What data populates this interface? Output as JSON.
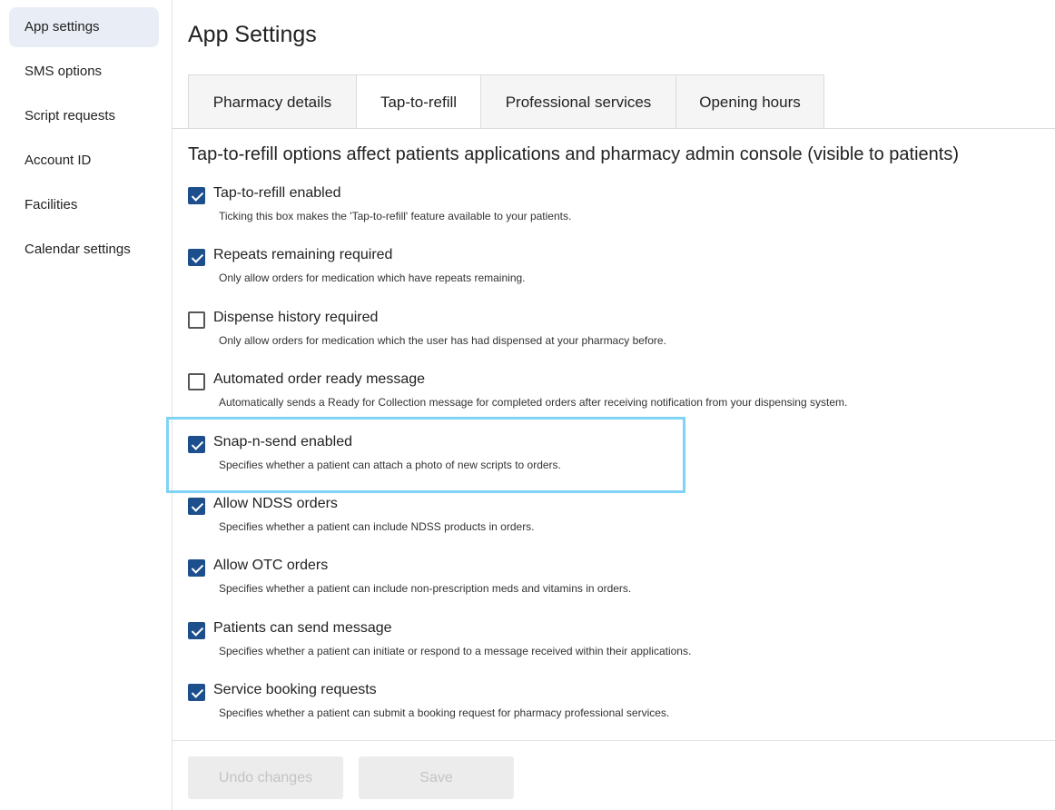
{
  "sidebar": {
    "items": [
      {
        "label": "App settings",
        "active": true
      },
      {
        "label": "SMS options"
      },
      {
        "label": "Script requests"
      },
      {
        "label": "Account ID"
      },
      {
        "label": "Facilities"
      },
      {
        "label": "Calendar settings"
      }
    ]
  },
  "page": {
    "title": "App Settings"
  },
  "tabs": [
    {
      "label": "Pharmacy details"
    },
    {
      "label": "Tap-to-refill",
      "active": true
    },
    {
      "label": "Professional services"
    },
    {
      "label": "Opening hours"
    }
  ],
  "section": {
    "heading": "Tap-to-refill options affect patients applications and pharmacy admin console (visible to patients)"
  },
  "options": [
    {
      "label": "Tap-to-refill enabled",
      "description": "Ticking this box makes the 'Tap-to-refill' feature available to your patients.",
      "checked": true
    },
    {
      "label": "Repeats remaining required",
      "description": "Only allow orders for medication which have repeats remaining.",
      "checked": true
    },
    {
      "label": "Dispense history required",
      "description": "Only allow orders for medication which the user has had dispensed at your pharmacy before.",
      "checked": false
    },
    {
      "label": "Automated order ready message",
      "description": "Automatically sends a Ready for Collection message for completed orders after receiving notification from your dispensing system.",
      "checked": false
    },
    {
      "label": "Snap-n-send enabled",
      "description": "Specifies whether a patient can attach a photo of new scripts to orders.",
      "checked": true
    },
    {
      "label": "Allow NDSS orders",
      "description": "Specifies whether a patient can include NDSS products in orders.",
      "checked": true
    },
    {
      "label": "Allow OTC orders",
      "description": "Specifies whether a patient can include non-prescription meds and vitamins in orders.",
      "checked": true
    },
    {
      "label": "Patients can send message",
      "description": "Specifies whether a patient can initiate or respond to a message received within their applications.",
      "checked": true
    },
    {
      "label": "Service booking requests",
      "description": "Specifies whether a patient can submit a booking request for pharmacy professional services.",
      "checked": true
    }
  ],
  "footer": {
    "undo_label": "Undo changes",
    "save_label": "Save"
  },
  "colors": {
    "checkbox_checked": "#1c4f8c",
    "highlight": "#7fd3f5",
    "active_nav_bg": "#e9edf5"
  }
}
